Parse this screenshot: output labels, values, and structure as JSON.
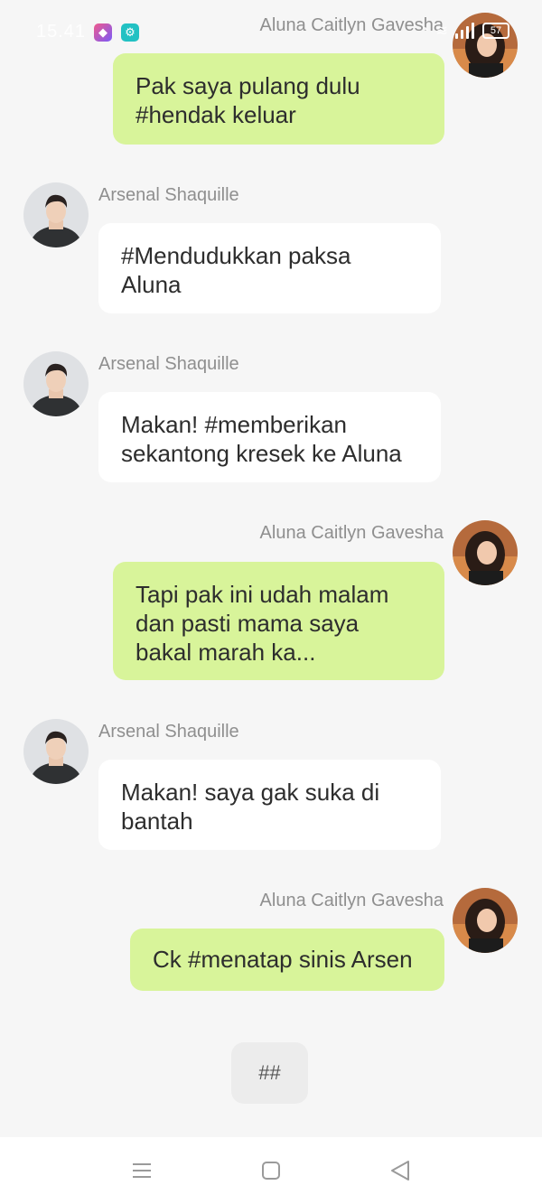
{
  "status_bar": {
    "time": "15.41",
    "battery": "57"
  },
  "contacts": {
    "aluna": "Aluna Caitlyn Gavesha",
    "arsenal": "Arsenal Shaquille"
  },
  "messages": [
    {
      "sender": "Aluna Caitlyn Gavesha",
      "text": "Pak saya pulang dulu\n#hendak keluar",
      "direction": "outgoing"
    },
    {
      "sender": "Arsenal Shaquille",
      "text": "#Mendudukkan paksa\nAluna",
      "direction": "incoming"
    },
    {
      "sender": "Arsenal Shaquille",
      "text": "Makan! #memberikan\nsekantong kresek ke Aluna",
      "direction": "incoming"
    },
    {
      "sender": "Aluna Caitlyn Gavesha",
      "text": "Tapi pak ini udah malam\ndan pasti mama saya\nbakal marah ka...",
      "direction": "outgoing"
    },
    {
      "sender": "Arsenal Shaquille",
      "text": "Makan! saya gak suka di\nbantah",
      "direction": "incoming"
    },
    {
      "sender": "Aluna Caitlyn Gavesha",
      "text": "Ck #menatap sinis Arsen",
      "direction": "outgoing"
    }
  ],
  "action_button": {
    "label": "##"
  },
  "navigation": {
    "menu_icon": "menu-icon",
    "home_icon": "home-square-icon",
    "back_icon": "back-triangle-icon"
  },
  "colors": {
    "outgoing_bubble": "#d8f49a",
    "incoming_bubble": "#ffffff",
    "background": "#f6f6f6",
    "sender_name": "#8f8f8f"
  }
}
